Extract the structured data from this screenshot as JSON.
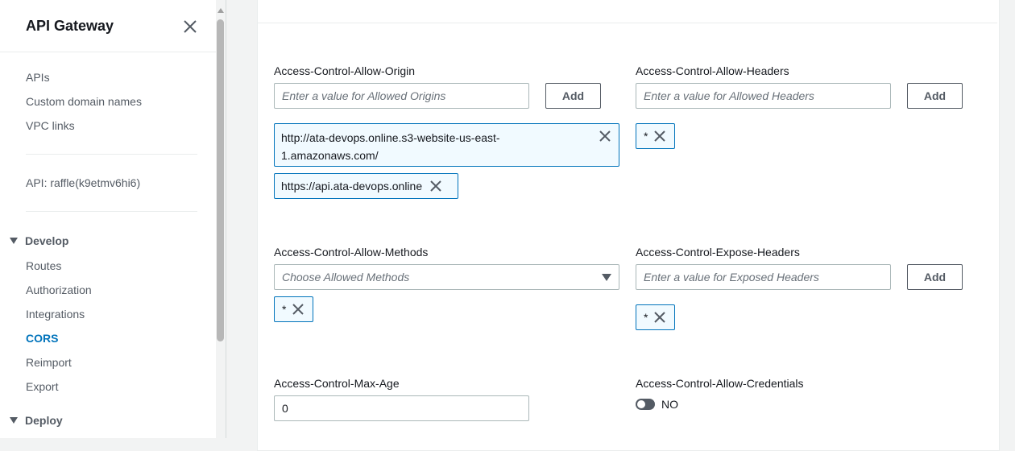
{
  "sidebar": {
    "title": "API Gateway",
    "links_top": [
      "APIs",
      "Custom domain names",
      "VPC links"
    ],
    "api_label": "API: raffle(k9etmv6hi6)",
    "develop": {
      "label": "Develop",
      "items": [
        "Routes",
        "Authorization",
        "Integrations",
        "CORS",
        "Reimport",
        "Export"
      ],
      "active": "CORS"
    },
    "deploy": {
      "label": "Deploy"
    }
  },
  "cors": {
    "allow_origin": {
      "label": "Access-Control-Allow-Origin",
      "placeholder": "Enter a value for Allowed Origins",
      "add_label": "Add",
      "tokens": [
        "http://ata-devops.online.s3-website-us-east-\n1.amazonaws.com/",
        "https://api.ata-devops.online"
      ]
    },
    "allow_headers": {
      "label": "Access-Control-Allow-Headers",
      "placeholder": "Enter a value for Allowed Headers",
      "add_label": "Add",
      "tokens": [
        "*"
      ]
    },
    "allow_methods": {
      "label": "Access-Control-Allow-Methods",
      "placeholder": "Choose Allowed Methods",
      "tokens": [
        "*"
      ]
    },
    "expose_headers": {
      "label": "Access-Control-Expose-Headers",
      "placeholder": "Enter a value for Exposed Headers",
      "add_label": "Add",
      "tokens": [
        "*"
      ]
    },
    "max_age": {
      "label": "Access-Control-Max-Age",
      "value": "0"
    },
    "allow_credentials": {
      "label": "Access-Control-Allow-Credentials",
      "state_label": "NO",
      "enabled": false
    }
  },
  "colors": {
    "accent": "#0073bb",
    "token_bg": "#f1faff",
    "sidebar_text": "#545b64"
  }
}
